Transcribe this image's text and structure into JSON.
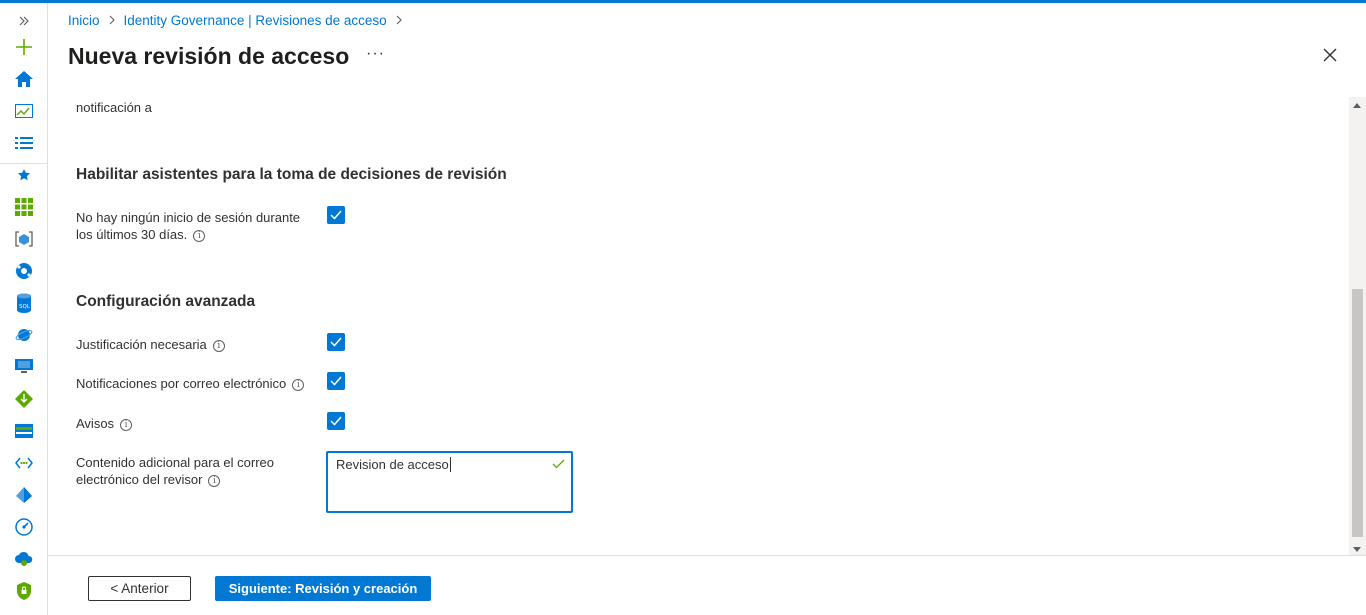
{
  "breadcrumb": {
    "items": [
      "Inicio",
      "Identity Governance | Revisiones de acceso"
    ]
  },
  "header": {
    "title": "Nueva revisión de acceso",
    "more": "···"
  },
  "form": {
    "cut_label": "notificación a",
    "section_helpers": "Habilitar asistentes para la toma de decisiones de revisión",
    "no_signin_label_line1": "No hay ningún inicio de sesión durante",
    "no_signin_label_line2": "los últimos 30 días.",
    "no_signin_checked": true,
    "section_advanced": "Configuración avanzada",
    "justification_label": "Justificación necesaria",
    "justification_checked": true,
    "email_notifications_label": "Notificaciones por correo electrónico",
    "email_notifications_checked": true,
    "reminders_label": "Avisos",
    "reminders_checked": true,
    "extra_content_label_line1": "Contenido adicional para el correo",
    "extra_content_label_line2": "electrónico del revisor",
    "extra_content_value": "Revision de acceso"
  },
  "footer": {
    "prev_label": "< Anterior",
    "next_label": "Siguiente: Revisión y creación"
  },
  "colors": {
    "accent": "#0078d4",
    "text": "#323130"
  }
}
